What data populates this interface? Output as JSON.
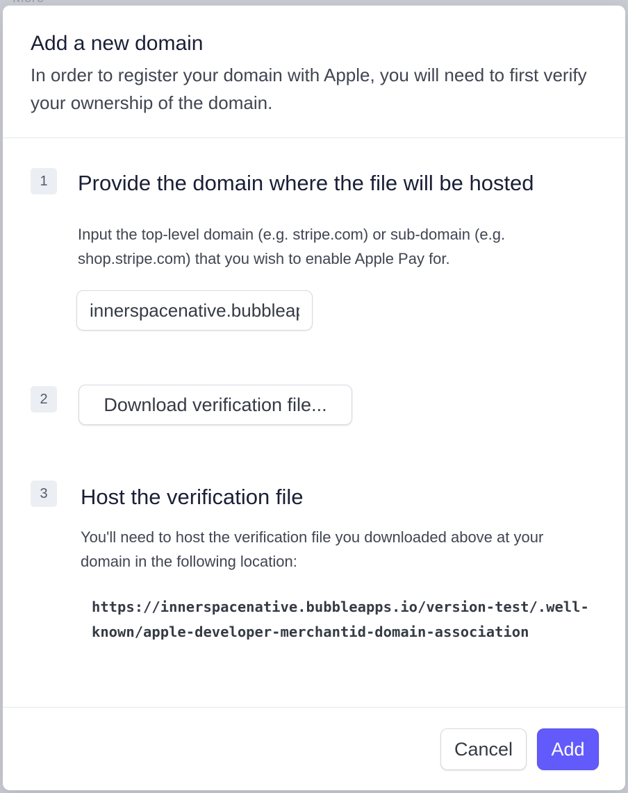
{
  "background": {
    "peek_text": "More"
  },
  "modal": {
    "title": "Add a new domain",
    "subtitle": "In order to register your domain with Apple, you will need to first verify your ownership of the domain."
  },
  "steps": [
    {
      "number": "1",
      "title": "Provide the domain where the file will be hosted",
      "description": "Input the top-level domain (e.g. stripe.com) or sub-domain (e.g. shop.stripe.com) that you wish to enable Apple Pay for.",
      "input_value": "innerspacenative.bubbleapps.io"
    },
    {
      "number": "2",
      "button_label": "Download verification file..."
    },
    {
      "number": "3",
      "title": "Host the verification file",
      "description": "You'll need to host the verification file you downloaded above at your domain in the following location:",
      "path": "https://innerspacenative.bubbleapps.io/version-test/.well-known/apple-developer-merchantid-domain-association"
    }
  ],
  "footer": {
    "cancel_label": "Cancel",
    "add_label": "Add"
  },
  "colors": {
    "primary": "#625afa",
    "text": "#1a1f36",
    "muted_text": "#414552",
    "border": "#e3e6ec"
  }
}
